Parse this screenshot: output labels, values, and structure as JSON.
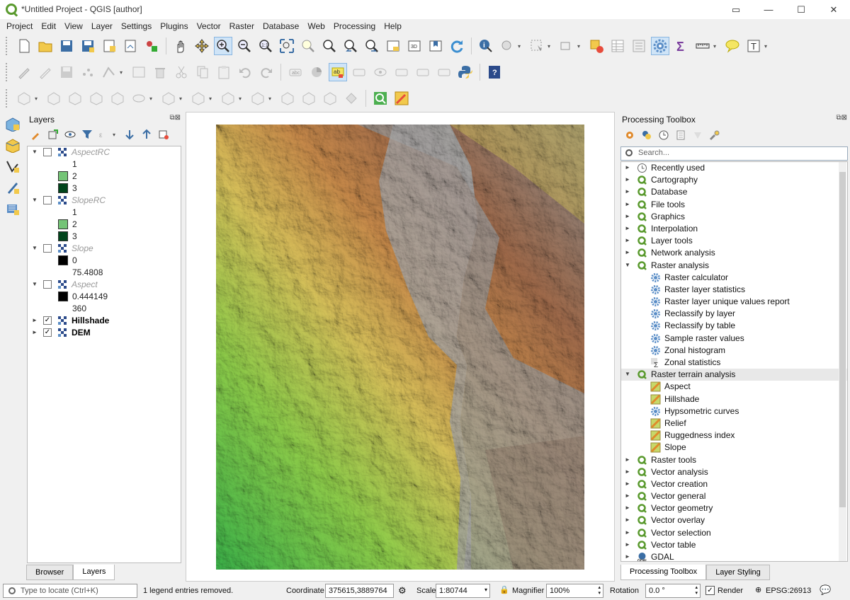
{
  "window": {
    "title": "*Untitled Project - QGIS [author]"
  },
  "menu": [
    "Project",
    "Edit",
    "View",
    "Layer",
    "Settings",
    "Plugins",
    "Vector",
    "Raster",
    "Database",
    "Web",
    "Processing",
    "Help"
  ],
  "layers_panel": {
    "title": "Layers",
    "items": [
      {
        "name": "AspectRC",
        "checked": false,
        "expanded": true,
        "legend": [
          {
            "label": "1",
            "color": "#ffffff"
          },
          {
            "label": "2",
            "color": "#74c476"
          },
          {
            "label": "3",
            "color": "#00441b"
          }
        ]
      },
      {
        "name": "SlopeRC",
        "checked": false,
        "expanded": true,
        "legend": [
          {
            "label": "1",
            "color": "#ffffff"
          },
          {
            "label": "2",
            "color": "#74c476"
          },
          {
            "label": "3",
            "color": "#00441b"
          }
        ]
      },
      {
        "name": "Slope",
        "checked": false,
        "expanded": true,
        "legend": [
          {
            "label": "0",
            "color": "#000000"
          },
          {
            "label": "75.4808",
            "color": null
          }
        ]
      },
      {
        "name": "Aspect",
        "checked": false,
        "expanded": true,
        "legend": [
          {
            "label": "0.444149",
            "color": "#000000"
          },
          {
            "label": "360",
            "color": null
          }
        ]
      },
      {
        "name": "Hillshade",
        "checked": true,
        "expanded": false,
        "legend": []
      },
      {
        "name": "DEM",
        "checked": true,
        "expanded": false,
        "legend": []
      }
    ]
  },
  "bottom_tabs_left": {
    "browser": "Browser",
    "layers": "Layers"
  },
  "processing": {
    "title": "Processing Toolbox",
    "search_placeholder": "Search...",
    "rows": [
      {
        "label": "Recently used",
        "level": 0,
        "icon": "clock-icon",
        "arrow": "►"
      },
      {
        "label": "Cartography",
        "level": 0,
        "icon": "qgis-icon",
        "arrow": "►"
      },
      {
        "label": "Database",
        "level": 0,
        "icon": "qgis-icon",
        "arrow": "►"
      },
      {
        "label": "File tools",
        "level": 0,
        "icon": "qgis-icon",
        "arrow": "►"
      },
      {
        "label": "Graphics",
        "level": 0,
        "icon": "qgis-icon",
        "arrow": "►"
      },
      {
        "label": "Interpolation",
        "level": 0,
        "icon": "qgis-icon",
        "arrow": "►"
      },
      {
        "label": "Layer tools",
        "level": 0,
        "icon": "qgis-icon",
        "arrow": "►"
      },
      {
        "label": "Network analysis",
        "level": 0,
        "icon": "qgis-icon",
        "arrow": "►"
      },
      {
        "label": "Raster analysis",
        "level": 0,
        "icon": "qgis-icon",
        "arrow": "▼"
      },
      {
        "label": "Raster calculator",
        "level": 1,
        "icon": "gear-icon",
        "arrow": ""
      },
      {
        "label": "Raster layer statistics",
        "level": 1,
        "icon": "gear-icon",
        "arrow": ""
      },
      {
        "label": "Raster layer unique values report",
        "level": 1,
        "icon": "gear-icon",
        "arrow": ""
      },
      {
        "label": "Reclassify by layer",
        "level": 1,
        "icon": "gear-icon",
        "arrow": ""
      },
      {
        "label": "Reclassify by table",
        "level": 1,
        "icon": "gear-icon",
        "arrow": ""
      },
      {
        "label": "Sample raster values",
        "level": 1,
        "icon": "gear-icon",
        "arrow": ""
      },
      {
        "label": "Zonal histogram",
        "level": 1,
        "icon": "gear-icon",
        "arrow": ""
      },
      {
        "label": "Zonal statistics",
        "level": 1,
        "icon": "sigma-icon",
        "arrow": ""
      },
      {
        "label": "Raster terrain analysis",
        "level": 0,
        "icon": "qgis-icon",
        "arrow": "▼",
        "highlight": true
      },
      {
        "label": "Aspect",
        "level": 1,
        "icon": "terrain-icon",
        "arrow": ""
      },
      {
        "label": "Hillshade",
        "level": 1,
        "icon": "terrain-icon",
        "arrow": ""
      },
      {
        "label": "Hypsometric curves",
        "level": 1,
        "icon": "gear-icon",
        "arrow": ""
      },
      {
        "label": "Relief",
        "level": 1,
        "icon": "terrain-icon",
        "arrow": ""
      },
      {
        "label": "Ruggedness index",
        "level": 1,
        "icon": "terrain-icon",
        "arrow": ""
      },
      {
        "label": "Slope",
        "level": 1,
        "icon": "terrain-icon",
        "arrow": ""
      },
      {
        "label": "Raster tools",
        "level": 0,
        "icon": "qgis-icon",
        "arrow": "►"
      },
      {
        "label": "Vector analysis",
        "level": 0,
        "icon": "qgis-icon",
        "arrow": "►"
      },
      {
        "label": "Vector creation",
        "level": 0,
        "icon": "qgis-icon",
        "arrow": "►"
      },
      {
        "label": "Vector general",
        "level": 0,
        "icon": "qgis-icon",
        "arrow": "►"
      },
      {
        "label": "Vector geometry",
        "level": 0,
        "icon": "qgis-icon",
        "arrow": "►"
      },
      {
        "label": "Vector overlay",
        "level": 0,
        "icon": "qgis-icon",
        "arrow": "►"
      },
      {
        "label": "Vector selection",
        "level": 0,
        "icon": "qgis-icon",
        "arrow": "►"
      },
      {
        "label": "Vector table",
        "level": 0,
        "icon": "qgis-icon",
        "arrow": "►"
      },
      {
        "label": "GDAL",
        "level": 0,
        "icon": "gdal-icon",
        "arrow": "►"
      }
    ]
  },
  "bottom_tabs_right": {
    "toolbox": "Processing Toolbox",
    "styling": "Layer Styling"
  },
  "status": {
    "locate_placeholder": "Type to locate (Ctrl+K)",
    "message": "1 legend entries removed.",
    "coordinate_label": "Coordinate",
    "coordinate": "375615,3889764",
    "scale_label": "Scale",
    "scale": "1:80744",
    "magnifier_label": "Magnifier",
    "magnifier": "100%",
    "rotation_label": "Rotation",
    "rotation": "0.0 °",
    "render_label": "Render",
    "crs": "EPSG:26913"
  }
}
